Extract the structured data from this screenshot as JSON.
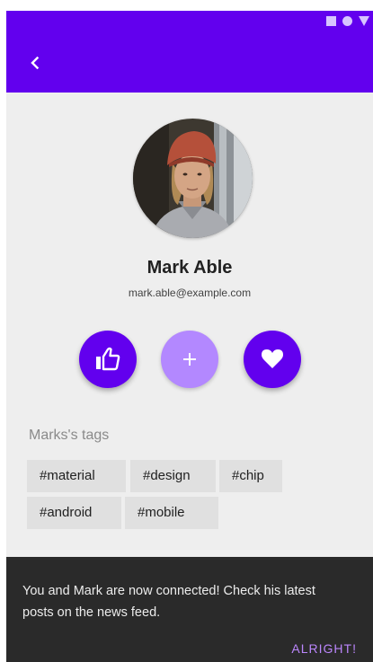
{
  "colors": {
    "primary": "#6200ee",
    "primary_light": "#b388ff",
    "background": "#eeeeee",
    "chip_background": "#e0e0e0",
    "snackbar_background": "#2a2a2a",
    "snackbar_action": "#bb86fc"
  },
  "appbar": {
    "back_icon": "chevron-left-icon"
  },
  "status_bar": {
    "icons": [
      "square-icon",
      "circle-icon",
      "triangle-down-icon"
    ]
  },
  "profile": {
    "avatar": "profile-photo",
    "name": "Mark Able",
    "email": "mark.able@example.com"
  },
  "actions": [
    {
      "icon": "thumbs-up-icon"
    },
    {
      "icon": "plus-icon"
    },
    {
      "icon": "heart-icon"
    }
  ],
  "tags": {
    "title": "Marks's tags",
    "chips": [
      "#material",
      "#design",
      "#chip",
      "#android",
      "#mobile"
    ]
  },
  "snackbar": {
    "message": "You and Mark are now connected! Check his latest posts on the news feed.",
    "action": "ALRIGHT!"
  }
}
